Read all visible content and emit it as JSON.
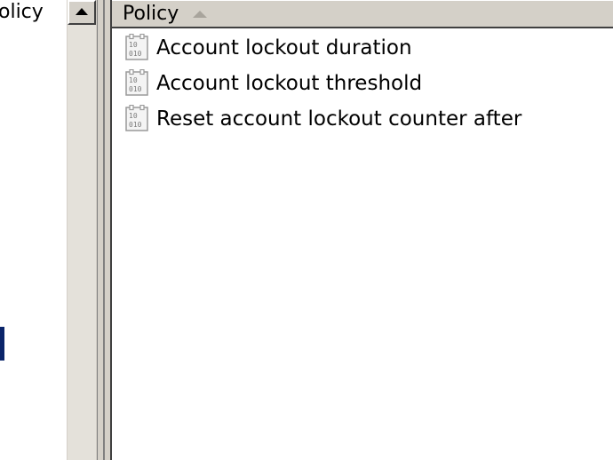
{
  "tree": {
    "partial_item_label": "olicy"
  },
  "list": {
    "column_header": "Policy",
    "items": [
      {
        "label": "Account lockout duration",
        "icon": "policy-binary-icon"
      },
      {
        "label": "Account lockout threshold",
        "icon": "policy-binary-icon"
      },
      {
        "label": "Reset account lockout counter after",
        "icon": "policy-binary-icon"
      }
    ]
  },
  "colors": {
    "chrome": "#d4d0c8",
    "window_bg": "#ffffff",
    "selection_edge": "#0a246a"
  }
}
